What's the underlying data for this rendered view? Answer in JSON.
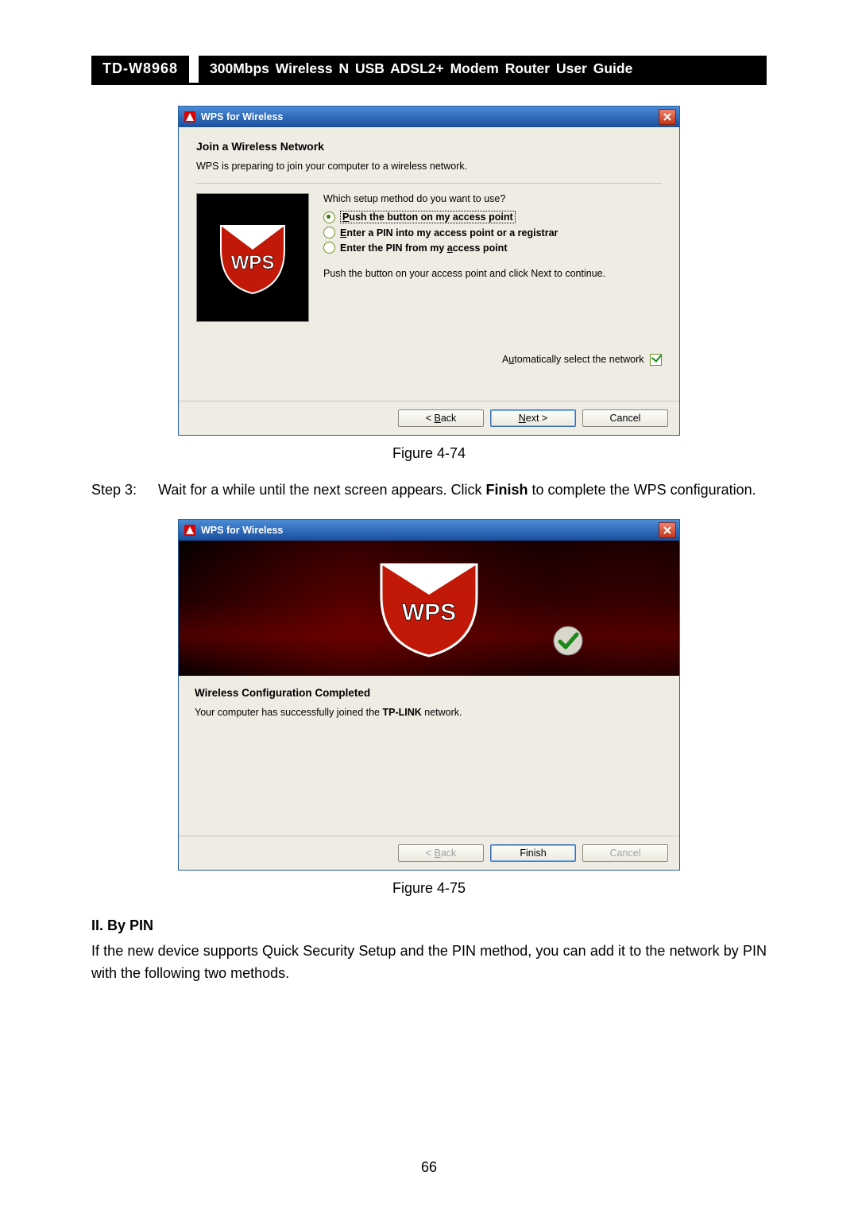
{
  "doc": {
    "model": "TD-W8968",
    "title": "300Mbps Wireless N USB ADSL2+ Modem Router User Guide"
  },
  "dialog1": {
    "window_title": "WPS for Wireless",
    "heading": "Join a Wireless Network",
    "intro": "WPS is preparing to join your computer to a wireless network.",
    "question": "Which setup method do you want to use?",
    "opt1_prefix": "P",
    "opt1_rest": "ush the button on my access point",
    "opt2_prefix": "E",
    "opt2_rest": "nter a PIN into my access point or a registrar",
    "opt3_prefix": "Enter the PIN from my ",
    "opt3_under": "a",
    "opt3_suffix": "ccess point",
    "instruction": "Push the button on your access point and click Next to continue.",
    "auto_prefix": "A",
    "auto_under": "u",
    "auto_suffix": "tomatically select the network",
    "btn_back_sym": "<",
    "btn_back_under": "B",
    "btn_back_rest": "ack",
    "btn_next_under": "N",
    "btn_next_rest": "ext >",
    "btn_cancel": "Cancel",
    "caption": "Figure 4-74"
  },
  "step3": {
    "label": "Step 3:",
    "before_bold": "Wait for a while until the next screen appears. Click ",
    "bold": "Finish",
    "after_bold": " to complete the WPS configuration."
  },
  "dialog2": {
    "window_title": "WPS for Wireless",
    "heading": "Wireless Configuration Completed",
    "msg_before": "Your computer has successfully joined the ",
    "msg_bold": "TP-LINK",
    "msg_after": " network.",
    "btn_back_sym": "<",
    "btn_back_under": "B",
    "btn_back_rest": "ack",
    "btn_finish": "Finish",
    "btn_cancel": "Cancel",
    "caption": "Figure 4-75"
  },
  "section": {
    "head": "II. By PIN",
    "para": "If the new device supports Quick Security Setup and the PIN method, you can add it to the network by PIN with the following two methods."
  },
  "page_number": "66"
}
